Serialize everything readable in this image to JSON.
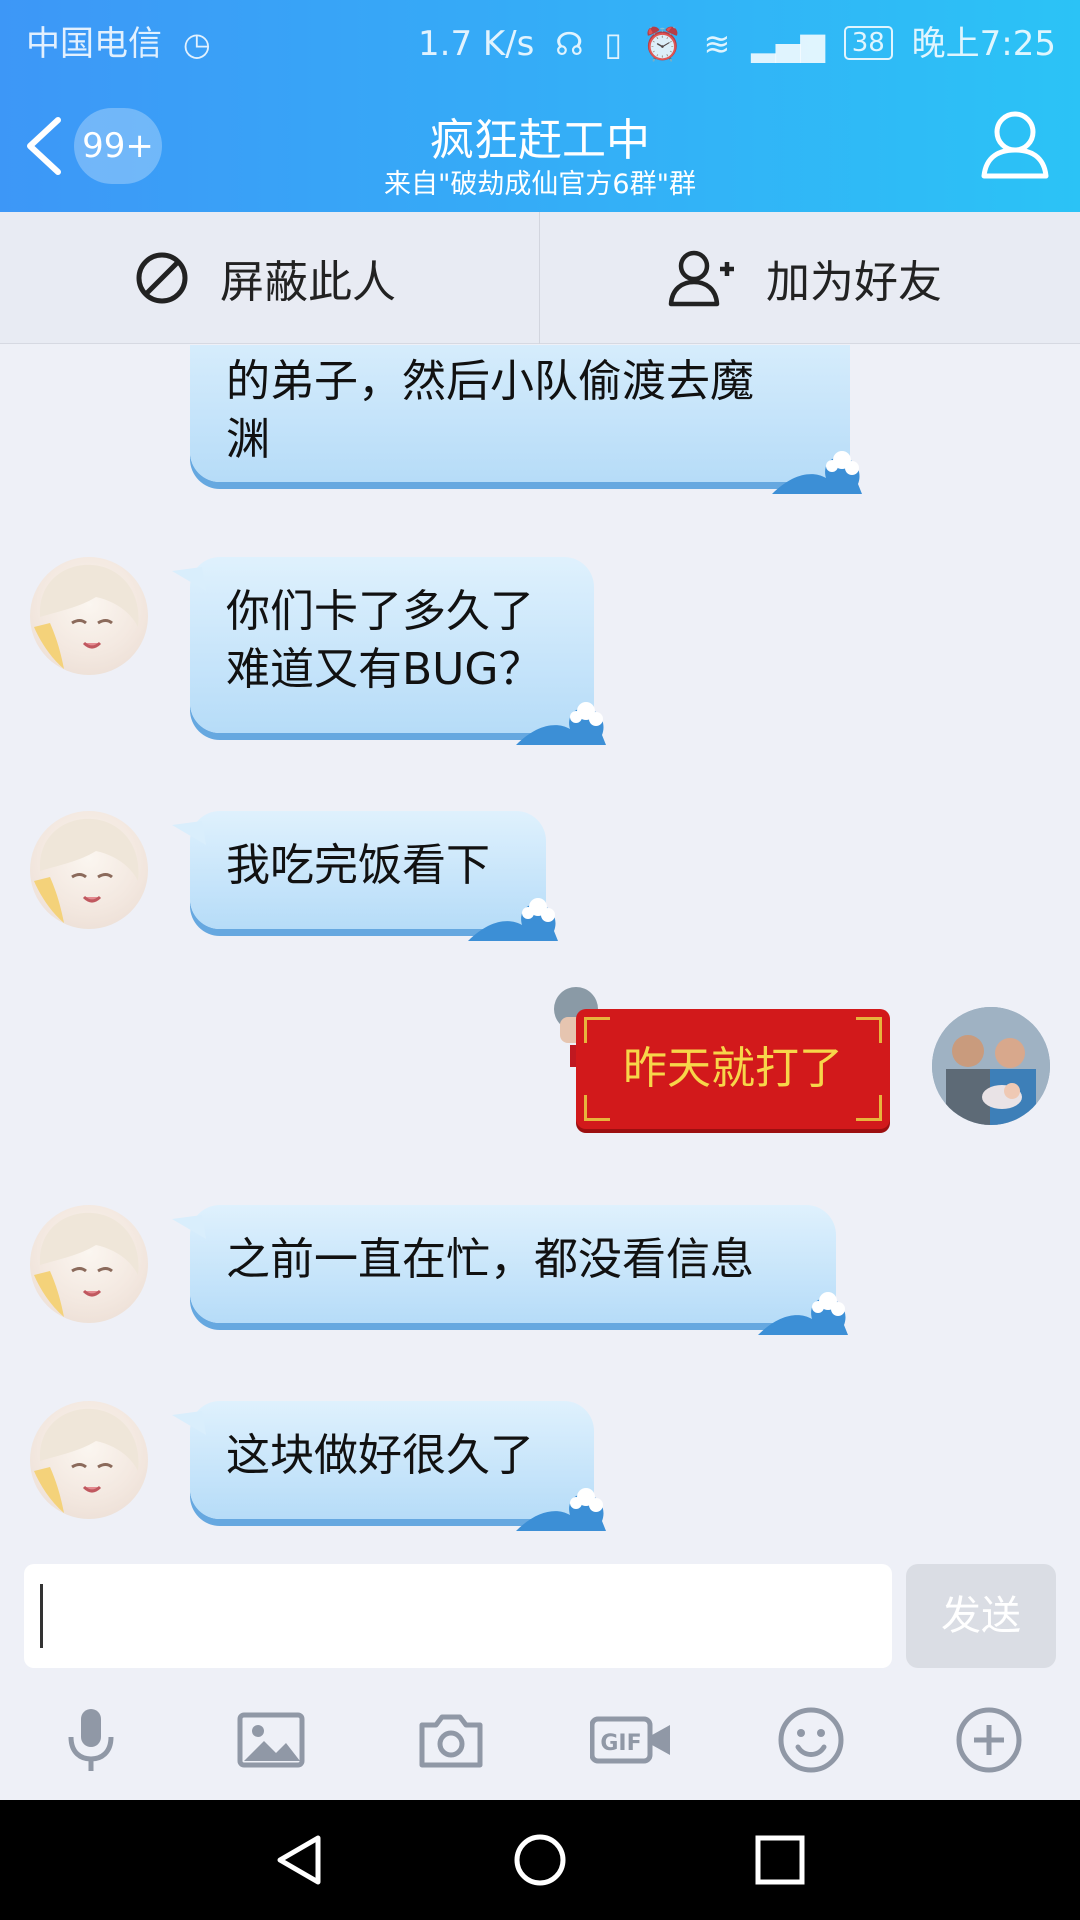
{
  "status_bar": {
    "carrier": "中国电信",
    "speed": "1.7 K/s",
    "battery": "38",
    "time": "晚上7:25"
  },
  "header": {
    "unread_count": "99+",
    "title": "疯狂赶工中",
    "subtitle": "来自\"破劫成仙官方6群\"群"
  },
  "actions": {
    "block_label": "屏蔽此人",
    "add_friend_label": "加为好友"
  },
  "messages": [
    {
      "side": "left",
      "text_lines": [
        "的弟子，然后小队偷渡去魔",
        "渊"
      ]
    },
    {
      "side": "left",
      "text_lines": [
        "你们卡了多久了",
        "难道又有BUG？"
      ]
    },
    {
      "side": "left",
      "text_lines": [
        "我吃完饭看下"
      ]
    },
    {
      "side": "right",
      "text_lines": [
        "昨天就打了"
      ]
    },
    {
      "side": "left",
      "text_lines": [
        "之前一直在忙，都没看信息"
      ]
    },
    {
      "side": "left",
      "text_lines": [
        "这块做好很久了"
      ]
    }
  ],
  "input": {
    "value": "",
    "send_label": "发送"
  },
  "toolbar": [
    "microphone-icon",
    "image-icon",
    "camera-icon",
    "gif-icon",
    "emoji-icon",
    "plus-icon"
  ],
  "colors": {
    "header_start": "#3d97f7",
    "header_end": "#2bc3f6",
    "bubble_light": "#dff1fd",
    "bubble_dark": "#b6dcf8",
    "red_bubble": "#d2191b",
    "red_bubble_text": "#f7d64a"
  }
}
